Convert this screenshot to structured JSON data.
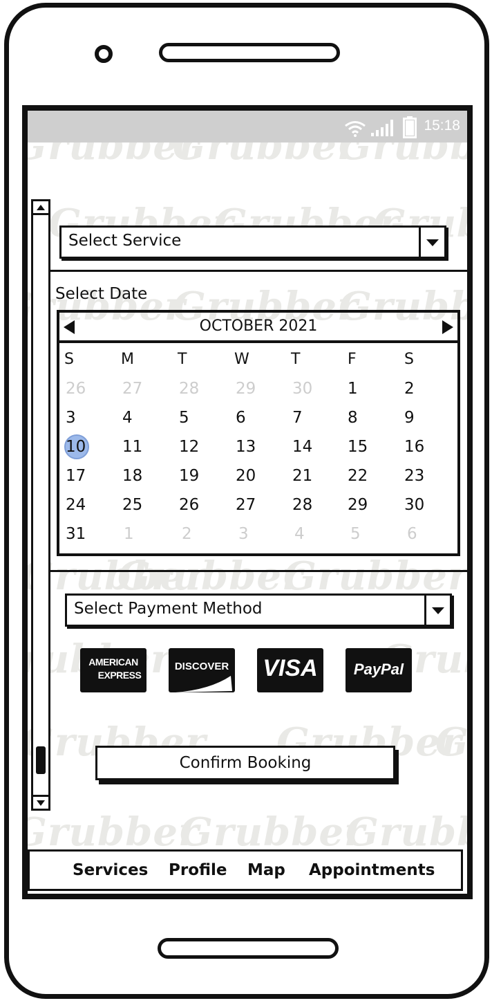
{
  "status_bar": {
    "time": "15:18"
  },
  "watermark": {
    "text": "Grubber"
  },
  "service_dropdown": {
    "label": "Select Service"
  },
  "date_section": {
    "label": "Select Date"
  },
  "calendar": {
    "month_label": "OCTOBER 2021",
    "weekdays": [
      "S",
      "M",
      "T",
      "W",
      "T",
      "F",
      "S"
    ],
    "weeks": [
      [
        "26",
        "27",
        "28",
        "29",
        "30",
        "1",
        "2"
      ],
      [
        "3",
        "4",
        "5",
        "6",
        "7",
        "8",
        "9"
      ],
      [
        "10",
        "11",
        "12",
        "13",
        "14",
        "15",
        "16"
      ],
      [
        "17",
        "18",
        "19",
        "20",
        "21",
        "22",
        "23"
      ],
      [
        "24",
        "25",
        "26",
        "27",
        "28",
        "29",
        "30"
      ],
      [
        "31",
        "1",
        "2",
        "3",
        "4",
        "5",
        "6"
      ]
    ],
    "selected_day": "10",
    "highlight_color": "#9cb9ea"
  },
  "payment_dropdown": {
    "label": "Select Payment Method"
  },
  "payment_methods": {
    "amex_line1": "AMERICAN",
    "amex_line2": "EXPRESS",
    "discover": "DISCOVER",
    "visa": "VISA",
    "paypal": "PayPal"
  },
  "confirm_button": {
    "label": "Confirm Booking"
  },
  "bottom_nav": {
    "services": "Services",
    "profile": "Profile",
    "map": "Map",
    "appointments": "Appointments"
  }
}
